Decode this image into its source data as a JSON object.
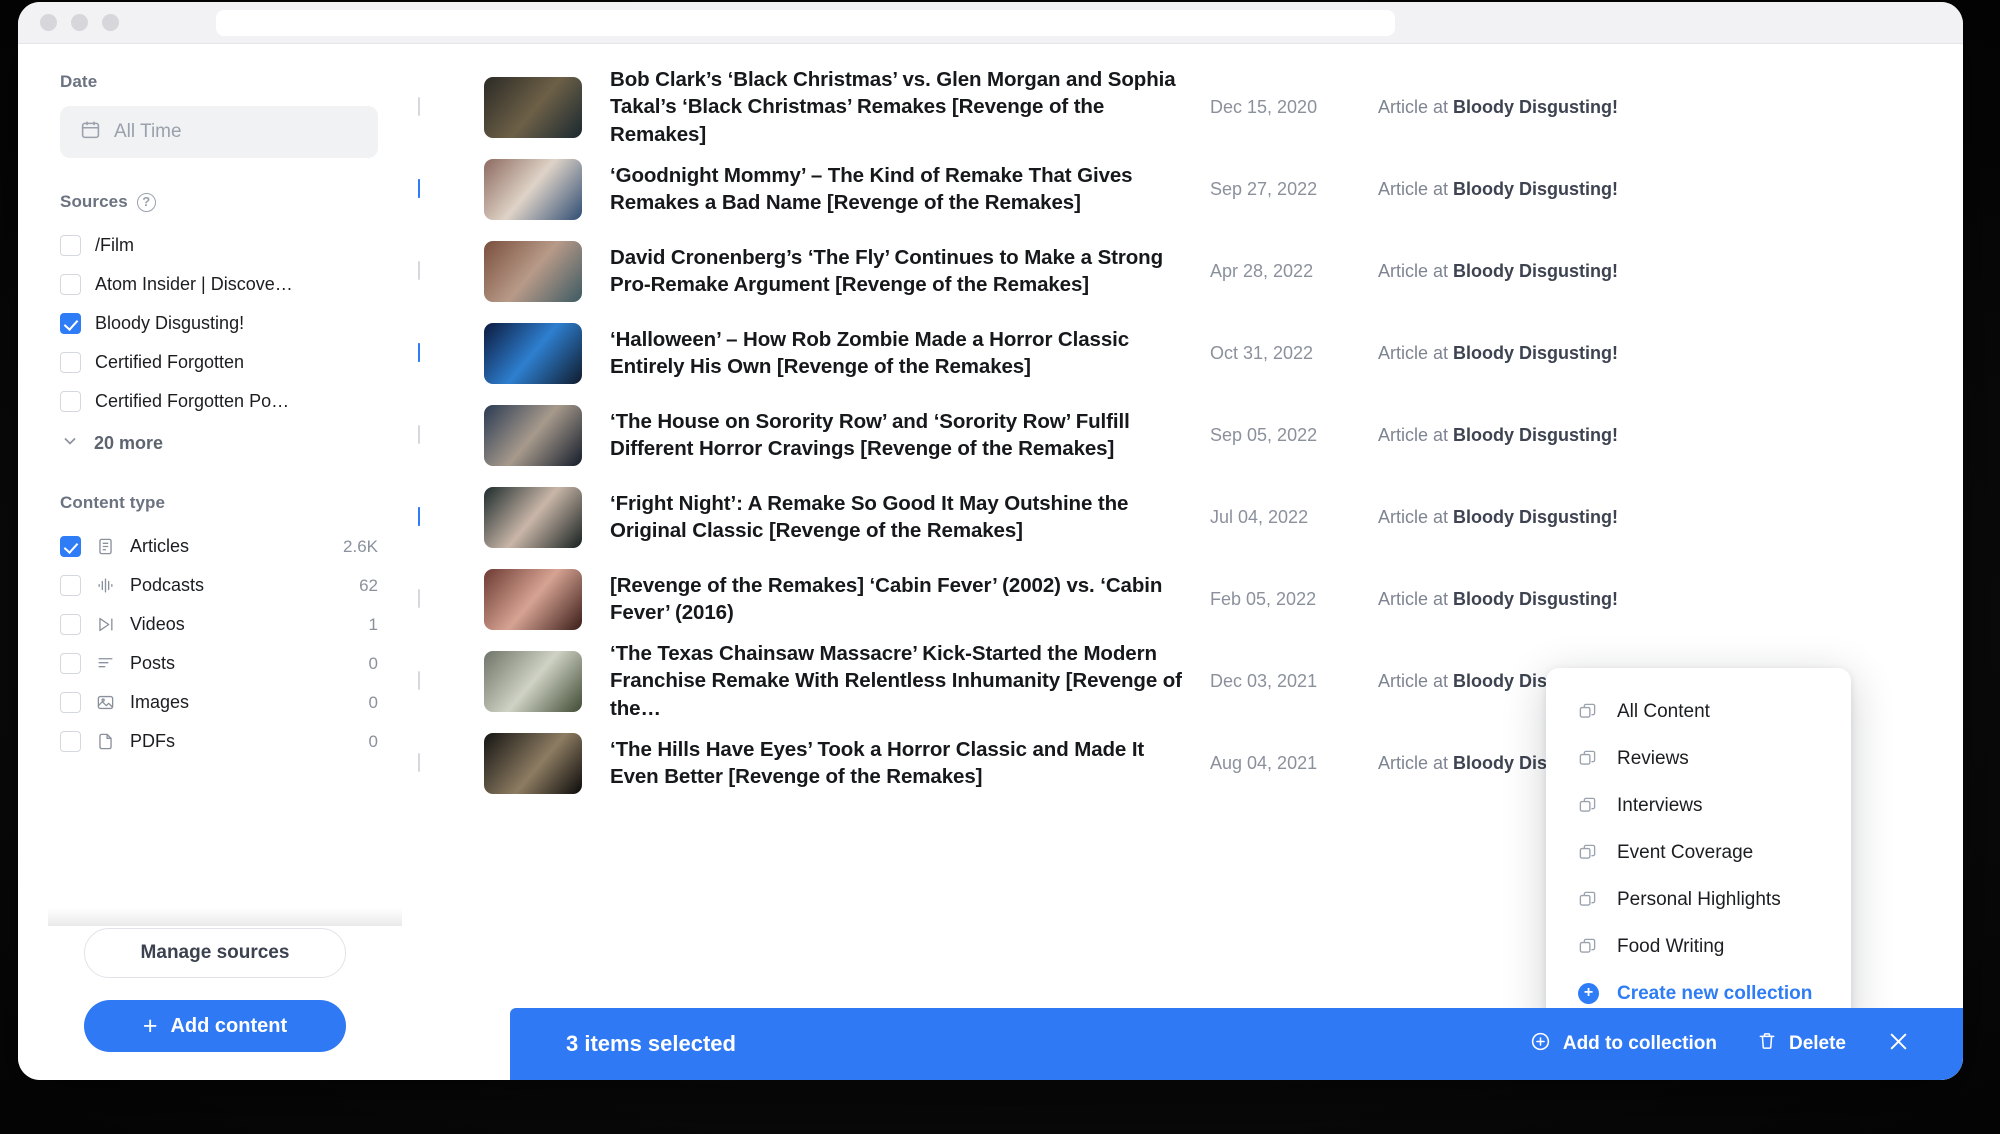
{
  "window": {
    "traffic_lights": [
      "close",
      "minimize",
      "zoom"
    ],
    "address_bar_value": ""
  },
  "sidebar": {
    "date": {
      "label": "Date",
      "field_value": "All Time",
      "icon": "calendar-icon"
    },
    "sources": {
      "label": "Sources",
      "help_icon": "question-mark-icon",
      "items": [
        {
          "label": "/Film",
          "checked": false
        },
        {
          "label": "Atom Insider | Discove…",
          "checked": false
        },
        {
          "label": "Bloody Disgusting!",
          "checked": true
        },
        {
          "label": "Certified Forgotten",
          "checked": false
        },
        {
          "label": "Certified Forgotten Po…",
          "checked": false
        }
      ],
      "more_label": "20 more"
    },
    "content_type": {
      "label": "Content type",
      "items": [
        {
          "label": "Articles",
          "count": "2.6K",
          "checked": true,
          "icon": "article-icon"
        },
        {
          "label": "Podcasts",
          "count": "62",
          "checked": false,
          "icon": "waveform-icon"
        },
        {
          "label": "Videos",
          "count": "1",
          "checked": false,
          "icon": "play-icon"
        },
        {
          "label": "Posts",
          "count": "0",
          "checked": false,
          "icon": "lines-icon"
        },
        {
          "label": "Images",
          "count": "0",
          "checked": false,
          "icon": "image-icon"
        },
        {
          "label": "PDFs",
          "count": "0",
          "checked": false,
          "icon": "file-icon"
        }
      ]
    },
    "manage_sources_label": "Manage sources",
    "add_content_label": "Add content"
  },
  "list": {
    "rows": [
      {
        "checked": false,
        "title": "Bob Clark’s ‘Black Christmas’ vs. Glen Morgan and Sophia Takal’s ‘Black Christmas’ Remakes [Revenge of the Remakes]",
        "date": "Dec 15, 2020",
        "source_prefix": "Article at ",
        "source_name": "Bloody Disgusting!",
        "thumb_colors": [
          "#2b2a26",
          "#6d6047",
          "#1a2830"
        ]
      },
      {
        "checked": true,
        "title": "‘Goodnight Mommy’ – The Kind of Remake That Gives Remakes a Bad Name [Revenge of the Remakes]",
        "date": "Sep 27, 2022",
        "source_prefix": "Article at ",
        "source_name": "Bloody Disgusting!",
        "thumb_colors": [
          "#8d6a60",
          "#dfd3c7",
          "#2f4d74"
        ]
      },
      {
        "checked": false,
        "title": "David Cronenberg’s ‘The Fly’ Continues to Make a Strong Pro-Remake Argument [Revenge of the Remakes]",
        "date": "Apr 28, 2022",
        "source_prefix": "Article at ",
        "source_name": "Bloody Disgusting!",
        "thumb_colors": [
          "#7a4f3e",
          "#b89a88",
          "#3c5a63"
        ]
      },
      {
        "checked": true,
        "title": "‘Halloween’ – How Rob Zombie Made a Horror Classic Entirely His Own [Revenge of the Remakes]",
        "date": "Oct 31, 2022",
        "source_prefix": "Article at ",
        "source_name": "Bloody Disgusting!",
        "thumb_colors": [
          "#0c1a3e",
          "#2e7fd0",
          "#101b2c"
        ]
      },
      {
        "checked": false,
        "title": "‘The House on Sorority Row’ and ‘Sorority Row’ Fulfill Different Horror Cravings [Revenge of the Remakes]",
        "date": "Sep 05, 2022",
        "source_prefix": "Article at ",
        "source_name": "Bloody Disgusting!",
        "thumb_colors": [
          "#2a3a52",
          "#a79a8c",
          "#141c2a"
        ]
      },
      {
        "checked": true,
        "title": "‘Fright Night’: A Remake So Good It May Outshine the Original Classic [Revenge of the Remakes]",
        "date": "Jul 04, 2022",
        "source_prefix": "Article at ",
        "source_name": "Bloody Disgusting!",
        "thumb_colors": [
          "#1d2b2c",
          "#c9b6a8",
          "#16201f"
        ]
      },
      {
        "checked": false,
        "title": "[Revenge of the Remakes] ‘Cabin Fever’ (2002) vs. ‘Cabin Fever’ (2016)",
        "date": "Feb 05, 2022",
        "source_prefix": "Article at ",
        "source_name": "Bloody Disgusting!",
        "thumb_colors": [
          "#6d3a33",
          "#d6a393",
          "#3a1c18"
        ]
      },
      {
        "checked": false,
        "title": "‘The Texas Chainsaw Massacre’ Kick-Started the Modern Franchise Remake With Relentless Inhumanity [Revenge of the…",
        "date": "Dec 03, 2021",
        "source_prefix": "Article at ",
        "source_name": "Bloody Disgusting!",
        "thumb_colors": [
          "#6f7468",
          "#cfd2c4",
          "#3f4a33"
        ]
      },
      {
        "checked": false,
        "title": "‘The Hills Have Eyes’ Took a Horror Classic and Made It Even Better [Revenge of the Remakes]",
        "date": "Aug 04, 2021",
        "source_prefix": "Article at ",
        "source_name": "Bloody Disgusting!",
        "thumb_colors": [
          "#151413",
          "#8d7c62",
          "#0b0a09"
        ]
      }
    ]
  },
  "collection_menu": {
    "items": [
      {
        "label": "All Content",
        "icon": "collection-icon"
      },
      {
        "label": "Reviews",
        "icon": "collection-icon"
      },
      {
        "label": "Interviews",
        "icon": "collection-icon"
      },
      {
        "label": "Event Coverage",
        "icon": "collection-icon"
      },
      {
        "label": "Personal Highlights",
        "icon": "collection-icon"
      },
      {
        "label": "Food Writing",
        "icon": "collection-icon"
      }
    ],
    "create_label": "Create new collection"
  },
  "selection_bar": {
    "count_label": "3 items selected",
    "add_to_collection_label": "Add to collection",
    "delete_label": "Delete",
    "close_icon": "close-icon"
  },
  "colors": {
    "accent": "#3079f4",
    "checkbox_on": "#2f7df6",
    "muted_text": "#8b919c",
    "title_text": "#16181c"
  }
}
